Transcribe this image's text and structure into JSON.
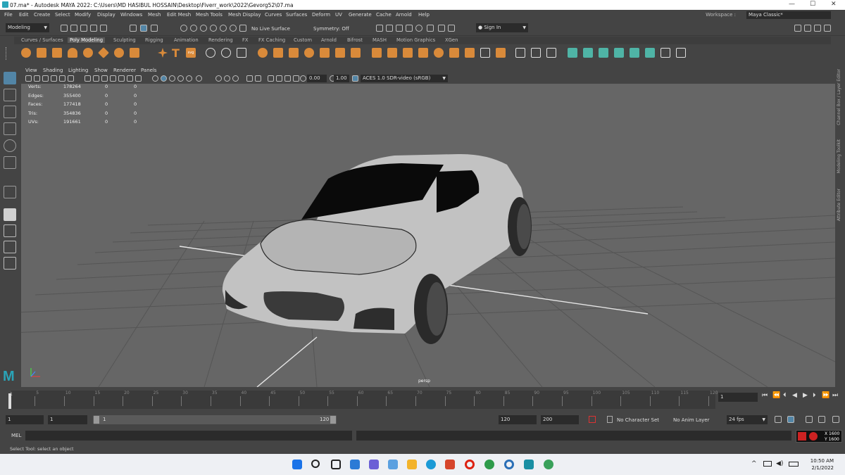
{
  "window": {
    "title": "07.ma* - Autodesk MAYA 2022: C:\\Users\\MD HASIBUL HOSSAIN\\Desktop\\Fiverr_work\\2022\\Gevorg52\\07.ma",
    "min": "—",
    "max": "☐",
    "close": "✕"
  },
  "menu": [
    "File",
    "Edit",
    "Create",
    "Select",
    "Modify",
    "Display",
    "Windows",
    "Mesh",
    "Edit Mesh",
    "Mesh Tools",
    "Mesh Display",
    "Curves",
    "Surfaces",
    "Deform",
    "UV",
    "Generate",
    "Cache",
    "Arnold",
    "Help"
  ],
  "workspace": {
    "label": "Workspace :",
    "value": "Maya Classic*"
  },
  "status": {
    "mode": "Modeling",
    "live_surface": "No Live Surface",
    "symmetry": "Symmetry: Off",
    "sign_in": "Sign In"
  },
  "shelf_tabs": [
    "Curves / Surfaces",
    "Poly Modeling",
    "Sculpting",
    "Rigging",
    "Animation",
    "Rendering",
    "FX",
    "FX Caching",
    "Custom",
    "Arnold",
    "Bifrost",
    "MASH",
    "Motion Graphics",
    "XGen"
  ],
  "shelf_active": "Poly Modeling",
  "viewport": {
    "menu": [
      "View",
      "Shading",
      "Lighting",
      "Show",
      "Renderer",
      "Panels"
    ],
    "exposure": "0.00",
    "gamma": "1.00",
    "colorspace": "ACES 1.0 SDR-video (sRGB)",
    "camera": "persp"
  },
  "hud": [
    {
      "label": "Verts:",
      "v1": "178264",
      "v2": "0",
      "v3": "0"
    },
    {
      "label": "Edges:",
      "v1": "355400",
      "v2": "0",
      "v3": "0"
    },
    {
      "label": "Faces:",
      "v1": "177418",
      "v2": "0",
      "v3": "0"
    },
    {
      "label": "Tris:",
      "v1": "354836",
      "v2": "0",
      "v3": "0"
    },
    {
      "label": "UVs:",
      "v1": "191661",
      "v2": "0",
      "v3": "0"
    }
  ],
  "right_tabs": [
    "Channel Box / Layer Editor",
    "Modeling Toolkit",
    "Attribute Editor"
  ],
  "timeline": {
    "ticks": [
      "5",
      "10",
      "15",
      "20",
      "25",
      "30",
      "35",
      "40",
      "45",
      "50",
      "55",
      "60",
      "65",
      "70",
      "75",
      "80",
      "85",
      "90",
      "95",
      "100",
      "105",
      "110",
      "115",
      "120"
    ],
    "current": "1",
    "ruler_start": "1"
  },
  "range": {
    "start": "1",
    "playback_start": "1",
    "slider_start": "1",
    "slider_end": "120",
    "playback_end": "120",
    "end": "200",
    "character_set": "No Character Set",
    "anim_layer": "No Anim Layer",
    "fps": "24 fps"
  },
  "mel": {
    "label": "MEL"
  },
  "help_line": "Select Tool: select an object",
  "coords": {
    "x": "X 1600",
    "y": "Y 1600"
  },
  "clock": {
    "time": "10:50 AM",
    "date": "2/1/2022"
  },
  "colors": {
    "shelf_orange": "#d98a3a",
    "shelf_teal": "#4fb4a6",
    "viewport_bg": "#666666",
    "grid": "#555555"
  }
}
